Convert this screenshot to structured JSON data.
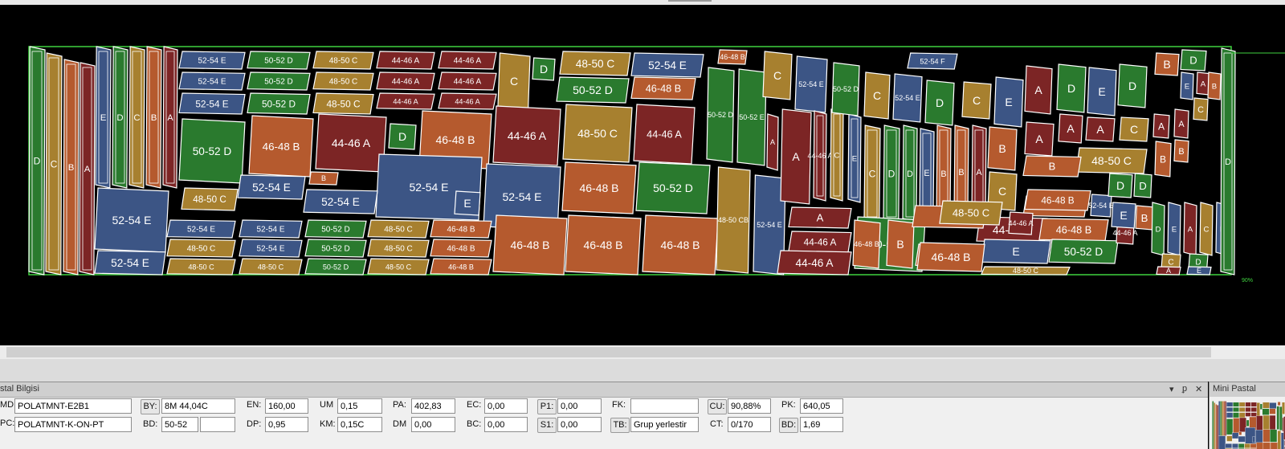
{
  "colors": {
    "A": "#7c2525",
    "B": "#b55a2e",
    "C": "#a7802f",
    "D": "#2a7a2e",
    "E": "#3c5585",
    "outline": "#ffffff",
    "border": "#3fd23f"
  },
  "marker": {
    "pieces": [
      {
        "label": "D",
        "color": "D"
      },
      {
        "label": "C",
        "color": "C"
      },
      {
        "label": "B",
        "color": "B"
      },
      {
        "label": "A",
        "color": "A"
      },
      {
        "label": "E",
        "color": "E"
      },
      {
        "label": "D",
        "color": "D"
      },
      {
        "label": "C",
        "color": "C"
      },
      {
        "label": "B",
        "color": "B"
      },
      {
        "label": "A",
        "color": "A"
      },
      {
        "label": "52-54 E",
        "color": "E"
      },
      {
        "label": "52-54 E",
        "color": "E"
      },
      {
        "label": "52-54 E",
        "color": "E"
      },
      {
        "label": "50-52 D",
        "color": "D"
      },
      {
        "label": "50-52 D",
        "color": "D"
      },
      {
        "label": "50-52 D",
        "color": "D"
      },
      {
        "label": "48-50 C",
        "color": "C"
      },
      {
        "label": "48-50 C",
        "color": "C"
      },
      {
        "label": "48-50 C",
        "color": "C"
      },
      {
        "label": "44-46 A",
        "color": "A"
      },
      {
        "label": "44-46 A",
        "color": "A"
      },
      {
        "label": "44-46 A",
        "color": "A"
      },
      {
        "label": "44-46 A",
        "color": "A"
      },
      {
        "label": "44-46 A",
        "color": "A"
      },
      {
        "label": "44-46 A",
        "color": "A"
      },
      {
        "label": "C",
        "color": "C"
      },
      {
        "label": "D",
        "color": "D"
      },
      {
        "label": "48-50 C",
        "color": "C"
      },
      {
        "label": "52-54 E",
        "color": "E"
      },
      {
        "label": "50-52 D",
        "color": "D"
      },
      {
        "label": "46-48 B",
        "color": "B"
      },
      {
        "label": "50-52 D",
        "color": "D"
      },
      {
        "label": "46-48 B",
        "color": "B"
      },
      {
        "label": "44-46 A",
        "color": "A"
      },
      {
        "label": "D",
        "color": "D"
      },
      {
        "label": "46-48 B",
        "color": "B"
      },
      {
        "label": "44-46 A",
        "color": "A"
      },
      {
        "label": "48-50 C",
        "color": "C"
      },
      {
        "label": "44-46 A",
        "color": "A"
      },
      {
        "label": "52-54 E",
        "color": "E"
      },
      {
        "label": "48-50 C",
        "color": "C"
      },
      {
        "label": "52-54 E",
        "color": "E"
      },
      {
        "label": "B",
        "color": "B"
      },
      {
        "label": "52-54 E",
        "color": "E"
      },
      {
        "label": "52-54 E",
        "color": "E"
      },
      {
        "label": "52-54 E",
        "color": "E"
      },
      {
        "label": "E",
        "color": "E"
      },
      {
        "label": "52-54 E",
        "color": "E"
      },
      {
        "label": "48-50 C",
        "color": "C"
      },
      {
        "label": "48-50 C",
        "color": "C"
      },
      {
        "label": "52-54 E",
        "color": "E"
      },
      {
        "label": "52-54 E",
        "color": "E"
      },
      {
        "label": "52-54 E",
        "color": "E"
      },
      {
        "label": "48-50 C",
        "color": "C"
      },
      {
        "label": "50-52 D",
        "color": "D"
      },
      {
        "label": "50-52 D",
        "color": "D"
      },
      {
        "label": "50-52 D",
        "color": "D"
      },
      {
        "label": "48-50 C",
        "color": "C"
      },
      {
        "label": "48-50 C",
        "color": "C"
      },
      {
        "label": "48-50 C",
        "color": "C"
      },
      {
        "label": "46-48 B",
        "color": "B"
      },
      {
        "label": "46-48 B",
        "color": "B"
      },
      {
        "label": "46-48 B",
        "color": "B"
      },
      {
        "label": "46-48 B",
        "color": "B"
      },
      {
        "label": "46-48 B",
        "color": "B"
      },
      {
        "label": "46-48 B",
        "color": "B"
      },
      {
        "label": "46-48 B",
        "color": "B"
      },
      {
        "label": "50-52 D",
        "color": "D"
      },
      {
        "label": "50-52 D",
        "color": "D"
      },
      {
        "label": "50-52 E",
        "color": "D"
      },
      {
        "label": "48-50 CB",
        "color": "C"
      },
      {
        "label": "52-54 E",
        "color": "E"
      },
      {
        "label": "46-48 B",
        "color": "B"
      },
      {
        "label": "C",
        "color": "C"
      },
      {
        "label": "52-54 E",
        "color": "E"
      },
      {
        "label": "A",
        "color": "A"
      },
      {
        "label": "A",
        "color": "A"
      },
      {
        "label": "44-46 A",
        "color": "A"
      },
      {
        "label": "C",
        "color": "C"
      },
      {
        "label": "E",
        "color": "E"
      },
      {
        "label": "C",
        "color": "C"
      },
      {
        "label": "D",
        "color": "D"
      },
      {
        "label": "D",
        "color": "D"
      },
      {
        "label": "E",
        "color": "E"
      },
      {
        "label": "B",
        "color": "B"
      },
      {
        "label": "B",
        "color": "B"
      },
      {
        "label": "A",
        "color": "A"
      },
      {
        "label": "A",
        "color": "A"
      },
      {
        "label": "44-46 A",
        "color": "A"
      },
      {
        "label": "44-46 A",
        "color": "A"
      },
      {
        "label": "50-52 D",
        "color": "D"
      },
      {
        "label": "46-48 B",
        "color": "B"
      },
      {
        "label": "48-50 C",
        "color": "C"
      },
      {
        "label": "52-54 F",
        "color": "E"
      },
      {
        "label": "50-52 D",
        "color": "D"
      },
      {
        "label": "C",
        "color": "C"
      },
      {
        "label": "52-54 E",
        "color": "E"
      },
      {
        "label": "D",
        "color": "D"
      },
      {
        "label": "C",
        "color": "C"
      },
      {
        "label": "E",
        "color": "E"
      },
      {
        "label": "A",
        "color": "A"
      },
      {
        "label": "D",
        "color": "D"
      },
      {
        "label": "E",
        "color": "E"
      },
      {
        "label": "D",
        "color": "D"
      },
      {
        "label": "B",
        "color": "B"
      },
      {
        "label": "C",
        "color": "C"
      },
      {
        "label": "A",
        "color": "A"
      },
      {
        "label": "B",
        "color": "B"
      },
      {
        "label": "44-46 A",
        "color": "A"
      },
      {
        "label": "46-48 B",
        "color": "B"
      },
      {
        "label": "B",
        "color": "B"
      },
      {
        "label": "B",
        "color": "B"
      },
      {
        "label": "48-50 C",
        "color": "C"
      },
      {
        "label": "44-46 A",
        "color": "A"
      },
      {
        "label": "E",
        "color": "E"
      },
      {
        "label": "46-48 B",
        "color": "B"
      },
      {
        "label": "50-52 D",
        "color": "D"
      },
      {
        "label": "46-48 B",
        "color": "B"
      },
      {
        "label": "46-48 B",
        "color": "B"
      },
      {
        "label": "48-50 C",
        "color": "C"
      },
      {
        "label": "44-46 A",
        "color": "A"
      },
      {
        "label": "52-54 E",
        "color": "E"
      },
      {
        "label": "D",
        "color": "D"
      },
      {
        "label": "C",
        "color": "C"
      },
      {
        "label": "A",
        "color": "A"
      },
      {
        "label": "A",
        "color": "A"
      },
      {
        "label": "B",
        "color": "B"
      },
      {
        "label": "E",
        "color": "E"
      },
      {
        "label": "D",
        "color": "D"
      },
      {
        "label": "B",
        "color": "B"
      },
      {
        "label": "A",
        "color": "A"
      },
      {
        "label": "B",
        "color": "B"
      },
      {
        "label": "A",
        "color": "A"
      },
      {
        "label": "B",
        "color": "B"
      },
      {
        "label": "C",
        "color": "C"
      },
      {
        "label": "D",
        "color": "D"
      },
      {
        "label": "E",
        "color": "E"
      },
      {
        "label": "A",
        "color": "A"
      },
      {
        "label": "C",
        "color": "C"
      },
      {
        "label": "E",
        "color": "E"
      },
      {
        "label": "B",
        "color": "B"
      },
      {
        "label": "D",
        "color": "D"
      },
      {
        "label": "E",
        "color": "E"
      },
      {
        "label": "A",
        "color": "A"
      },
      {
        "label": "B",
        "color": "B"
      },
      {
        "label": "C",
        "color": "C"
      },
      {
        "label": "D",
        "color": "D"
      },
      {
        "label": "A",
        "color": "A"
      },
      {
        "label": "E",
        "color": "E"
      },
      {
        "label": "D",
        "color": "D"
      },
      {
        "label": "C",
        "color": "C"
      },
      {
        "label": "D",
        "color": "D"
      },
      {
        "label": "E",
        "color": "E"
      }
    ],
    "progress_text": "90%"
  },
  "panel": {
    "title": "stal Bilgisi",
    "fields": {
      "md_label": "MD",
      "md_value": "POLATMNT-E2B1",
      "pc_label": "PC:",
      "pc_value": "POLATMNT-K-ON-PT",
      "by_label": "BY:",
      "by_value": "8M 44,04C",
      "bd_label": "BD:",
      "bd_value": "50-52",
      "bd_extra": "",
      "en_label": "EN:",
      "en_value": "160,00",
      "dp_label": "DP:",
      "dp_value": "0,95",
      "um_label": "UM",
      "um_value": "0,15",
      "km_label": "KM:",
      "km_value": "0,15C",
      "pa_label": "PA:",
      "pa_value": "402,83",
      "dm_label": "DM",
      "dm_value": "0,00",
      "ec_label": "EC:",
      "ec_value": "0,00",
      "bc_label": "BC:",
      "bc_value": "0,00",
      "p1_label": "P1:",
      "p1_value": "0,00",
      "s1_label": "S1:",
      "s1_value": "0,00",
      "fk_label": "FK:",
      "fk_value": "",
      "tb_label": "TB:",
      "tb_value": "Grup yerlestir",
      "cu_label": "CU:",
      "cu_value": "90,88%",
      "ct_label": "CT:",
      "ct_value": "0/170",
      "pk_label": "PK:",
      "pk_value": "640,05",
      "bd2_label": "BD:",
      "bd2_value": "1,69"
    }
  },
  "mini": {
    "title": "Mini Pastal"
  },
  "titlebar_buttons": {
    "dropdown": "▾",
    "pin": "ᵱ",
    "close": "✕"
  }
}
